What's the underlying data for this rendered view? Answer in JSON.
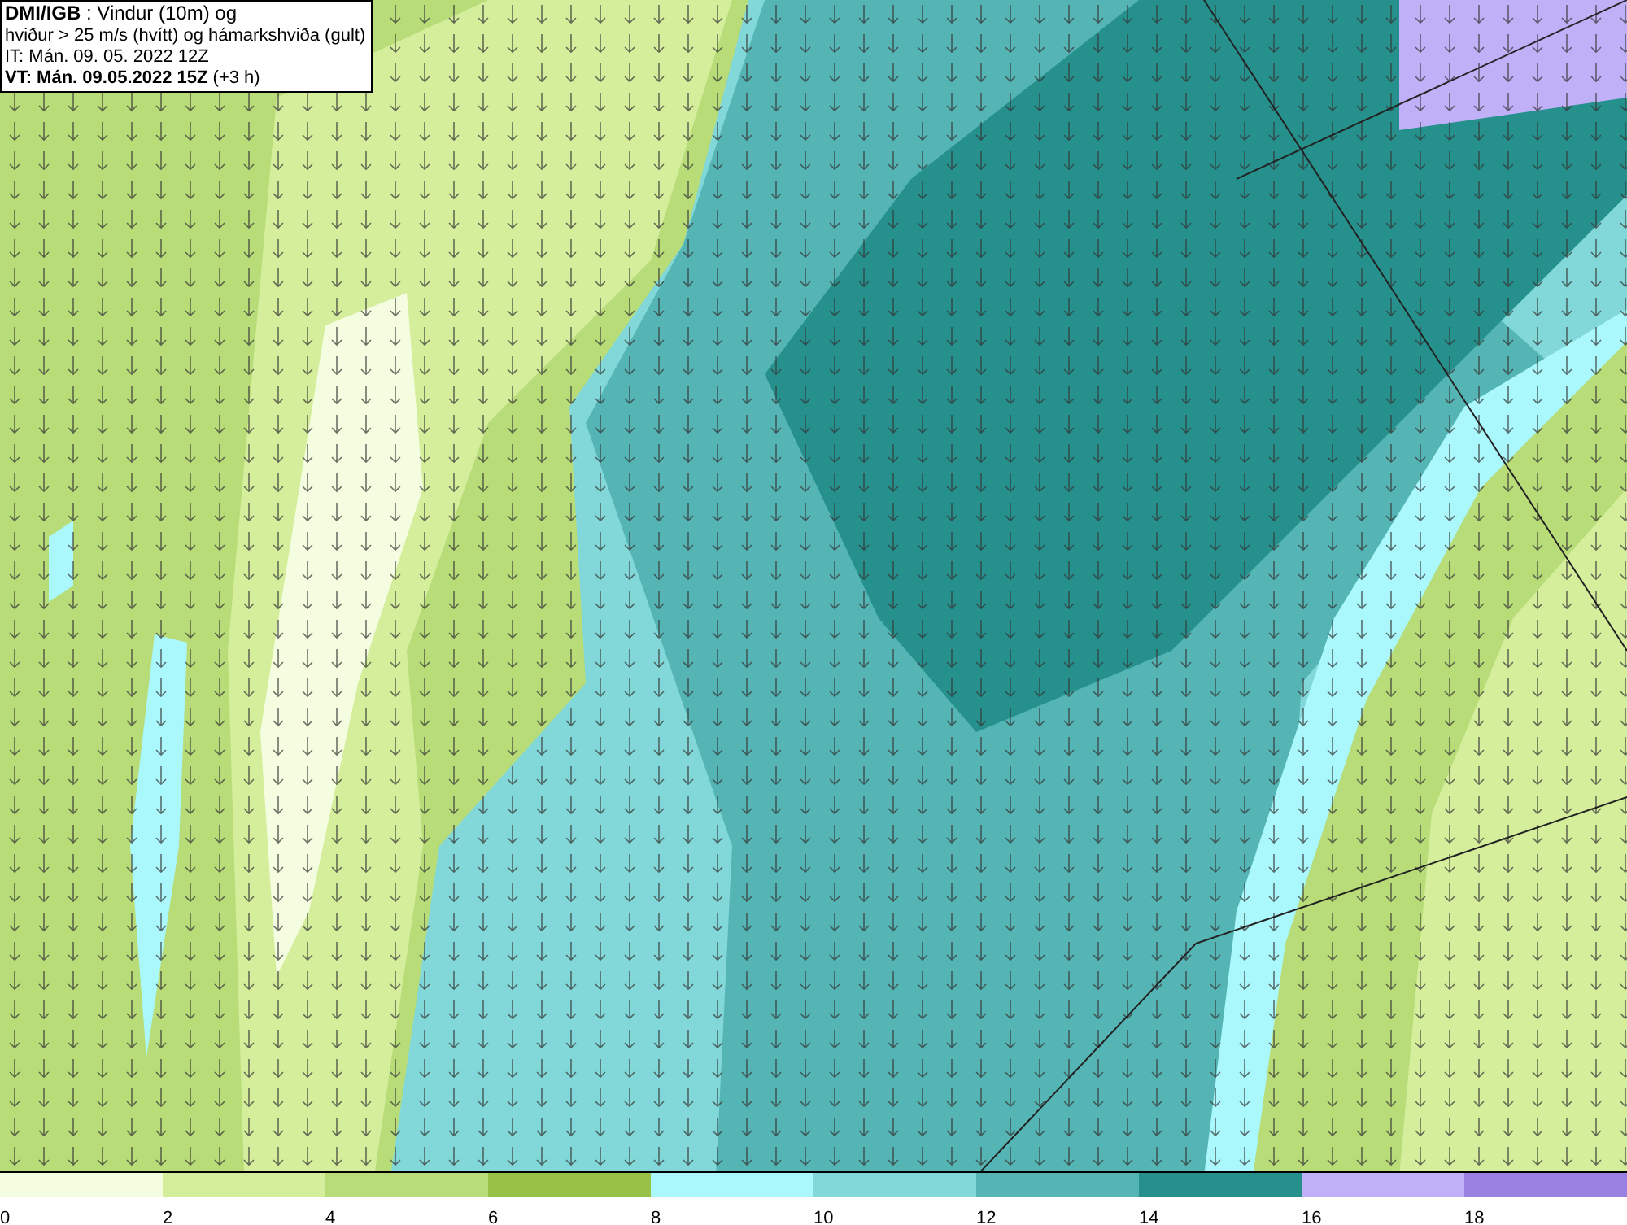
{
  "header": {
    "lines": [
      "**DMI/IGB** : Vindur (10m) og",
      "hviður > 25 m/s (hvítt) og hámarkshviða (gult)",
      "IT: Mán. 09. 05. 2022 12Z",
      "**VT: Mán. 09.05.2022 15Z** (+3 h)"
    ]
  },
  "legend": [
    {
      "label": "0",
      "color": "#f5fde0"
    },
    {
      "label": "2",
      "color": "#d4ee9c"
    },
    {
      "label": "4",
      "color": "#b8dc78"
    },
    {
      "label": "6",
      "color": "#98c148"
    },
    {
      "label": "8",
      "color": "#aaf8fc"
    },
    {
      "label": "10",
      "color": "#82d8d8"
    },
    {
      "label": "12",
      "color": "#55b4b4"
    },
    {
      "label": "14",
      "color": "#25908c"
    },
    {
      "label": "16",
      "color": "#c0b0f8"
    },
    {
      "label": "18",
      "color": "#9a80e0"
    }
  ]
}
